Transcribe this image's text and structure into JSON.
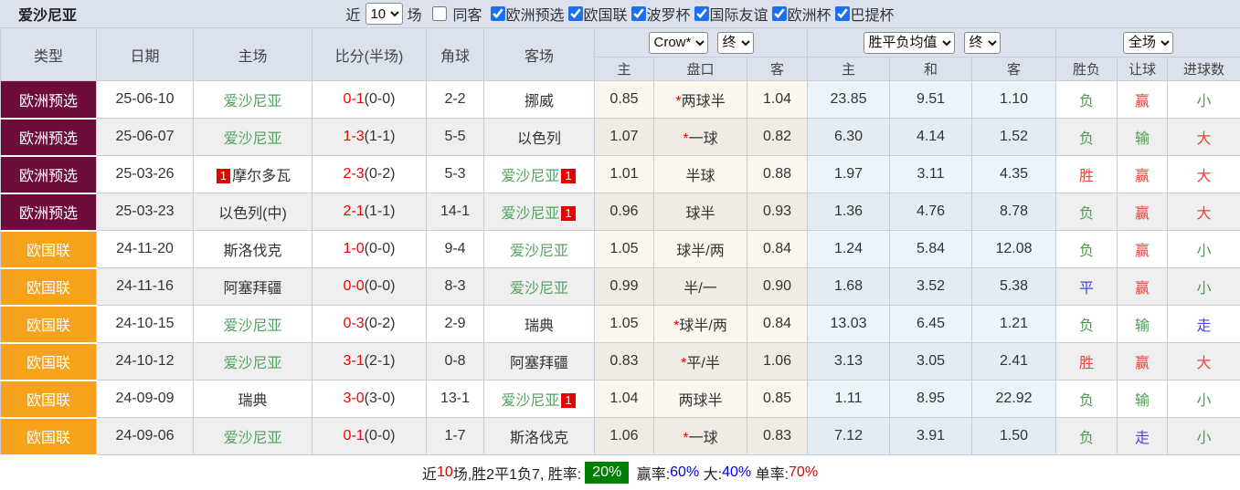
{
  "title": "爱沙尼亚",
  "topbar": {
    "near_label": "近",
    "near_value": "10",
    "games_label": "场",
    "same_away_label": "同客",
    "same_away_checked": false,
    "filters": [
      {
        "label": "欧洲预选",
        "checked": true
      },
      {
        "label": "欧国联",
        "checked": true
      },
      {
        "label": "波罗杯",
        "checked": true
      },
      {
        "label": "国际友谊",
        "checked": true
      },
      {
        "label": "欧洲杯",
        "checked": true
      },
      {
        "label": "巴提杯",
        "checked": true
      }
    ]
  },
  "header": {
    "cols": [
      "类型",
      "日期",
      "主场",
      "比分(半场)",
      "角球",
      "客场"
    ],
    "odds_company_dropdown": "Crow*",
    "odds_stage_dropdown": "终",
    "avg_type_dropdown": "胜平负均值",
    "avg_stage_dropdown": "终",
    "scope_dropdown": "全场",
    "sub_cols": [
      "主",
      "盘口",
      "客",
      "主",
      "和",
      "客",
      "胜负",
      "让球",
      "进球数"
    ]
  },
  "colors": {
    "league_maroon": "#6E0D3C",
    "league_orange": "#F7A21B",
    "team_highlight_green": "#55A163",
    "score_red": "#F00000",
    "result_red": "#E8453C",
    "result_green": "#4D9C51",
    "result_blue": "#4646E8",
    "footer_badge_green": "#008000"
  },
  "rows": [
    {
      "type": "欧洲预选",
      "type_color": "maroon",
      "date": "25-06-10",
      "home": "爱沙尼亚",
      "home_green": true,
      "home_badge_before": "",
      "home_badge_after": "",
      "score": "0-1",
      "half": "(0-0)",
      "corner": "2-2",
      "away": "挪威",
      "away_green": false,
      "away_badge_after": "",
      "odds_home": "0.85",
      "handicap_star": true,
      "handicap": "两球半",
      "odds_away": "1.04",
      "avg_win": "23.85",
      "avg_draw": "9.51",
      "avg_lose": "1.10",
      "result": {
        "text": "负",
        "color": "green"
      },
      "handicap_result": {
        "text": "赢",
        "color": "red"
      },
      "goals_result": {
        "text": "小",
        "color": "green"
      }
    },
    {
      "type": "欧洲预选",
      "type_color": "maroon",
      "date": "25-06-07",
      "home": "爱沙尼亚",
      "home_green": true,
      "home_badge_before": "",
      "home_badge_after": "",
      "score": "1-3",
      "half": "(1-1)",
      "corner": "5-5",
      "away": "以色列",
      "away_green": false,
      "away_badge_after": "",
      "odds_home": "1.07",
      "handicap_star": true,
      "handicap": "一球",
      "odds_away": "0.82",
      "avg_win": "6.30",
      "avg_draw": "4.14",
      "avg_lose": "1.52",
      "result": {
        "text": "负",
        "color": "green"
      },
      "handicap_result": {
        "text": "输",
        "color": "green"
      },
      "goals_result": {
        "text": "大",
        "color": "red"
      }
    },
    {
      "type": "欧洲预选",
      "type_color": "maroon",
      "date": "25-03-26",
      "home": "摩尔多瓦",
      "home_green": false,
      "home_badge_before": "1",
      "home_badge_after": "",
      "score": "2-3",
      "half": "(0-2)",
      "corner": "5-3",
      "away": "爱沙尼亚",
      "away_green": true,
      "away_badge_after": "1",
      "odds_home": "1.01",
      "handicap_star": false,
      "handicap": "半球",
      "odds_away": "0.88",
      "avg_win": "1.97",
      "avg_draw": "3.11",
      "avg_lose": "4.35",
      "result": {
        "text": "胜",
        "color": "red"
      },
      "handicap_result": {
        "text": "赢",
        "color": "red"
      },
      "goals_result": {
        "text": "大",
        "color": "red"
      }
    },
    {
      "type": "欧洲预选",
      "type_color": "maroon",
      "date": "25-03-23",
      "home": "以色列(中)",
      "home_green": false,
      "home_badge_before": "",
      "home_badge_after": "",
      "score": "2-1",
      "half": "(1-1)",
      "corner": "14-1",
      "away": "爱沙尼亚",
      "away_green": true,
      "away_badge_after": "1",
      "odds_home": "0.96",
      "handicap_star": false,
      "handicap": "球半",
      "odds_away": "0.93",
      "avg_win": "1.36",
      "avg_draw": "4.76",
      "avg_lose": "8.78",
      "result": {
        "text": "负",
        "color": "green"
      },
      "handicap_result": {
        "text": "赢",
        "color": "red"
      },
      "goals_result": {
        "text": "大",
        "color": "red"
      }
    },
    {
      "type": "欧国联",
      "type_color": "orange",
      "date": "24-11-20",
      "home": "斯洛伐克",
      "home_green": false,
      "home_badge_before": "",
      "home_badge_after": "",
      "score": "1-0",
      "half": "(0-0)",
      "corner": "9-4",
      "away": "爱沙尼亚",
      "away_green": true,
      "away_badge_after": "",
      "odds_home": "1.05",
      "handicap_star": false,
      "handicap": "球半/两",
      "odds_away": "0.84",
      "avg_win": "1.24",
      "avg_draw": "5.84",
      "avg_lose": "12.08",
      "result": {
        "text": "负",
        "color": "green"
      },
      "handicap_result": {
        "text": "赢",
        "color": "red"
      },
      "goals_result": {
        "text": "小",
        "color": "green"
      }
    },
    {
      "type": "欧国联",
      "type_color": "orange",
      "date": "24-11-16",
      "home": "阿塞拜疆",
      "home_green": false,
      "home_badge_before": "",
      "home_badge_after": "",
      "score": "0-0",
      "half": "(0-0)",
      "corner": "8-3",
      "away": "爱沙尼亚",
      "away_green": true,
      "away_badge_after": "",
      "odds_home": "0.99",
      "handicap_star": false,
      "handicap": "半/一",
      "odds_away": "0.90",
      "avg_win": "1.68",
      "avg_draw": "3.52",
      "avg_lose": "5.38",
      "result": {
        "text": "平",
        "color": "blue"
      },
      "handicap_result": {
        "text": "赢",
        "color": "red"
      },
      "goals_result": {
        "text": "小",
        "color": "green"
      }
    },
    {
      "type": "欧国联",
      "type_color": "orange",
      "date": "24-10-15",
      "home": "爱沙尼亚",
      "home_green": true,
      "home_badge_before": "",
      "home_badge_after": "",
      "score": "0-3",
      "half": "(0-2)",
      "corner": "2-9",
      "away": "瑞典",
      "away_green": false,
      "away_badge_after": "",
      "odds_home": "1.05",
      "handicap_star": true,
      "handicap": "球半/两",
      "odds_away": "0.84",
      "avg_win": "13.03",
      "avg_draw": "6.45",
      "avg_lose": "1.21",
      "result": {
        "text": "负",
        "color": "green"
      },
      "handicap_result": {
        "text": "输",
        "color": "green"
      },
      "goals_result": {
        "text": "走",
        "color": "blue"
      }
    },
    {
      "type": "欧国联",
      "type_color": "orange",
      "date": "24-10-12",
      "home": "爱沙尼亚",
      "home_green": true,
      "home_badge_before": "",
      "home_badge_after": "",
      "score": "3-1",
      "half": "(2-1)",
      "corner": "0-8",
      "away": "阿塞拜疆",
      "away_green": false,
      "away_badge_after": "",
      "odds_home": "0.83",
      "handicap_star": true,
      "handicap": "平/半",
      "odds_away": "1.06",
      "avg_win": "3.13",
      "avg_draw": "3.05",
      "avg_lose": "2.41",
      "result": {
        "text": "胜",
        "color": "red"
      },
      "handicap_result": {
        "text": "赢",
        "color": "red"
      },
      "goals_result": {
        "text": "大",
        "color": "red"
      }
    },
    {
      "type": "欧国联",
      "type_color": "orange",
      "date": "24-09-09",
      "home": "瑞典",
      "home_green": false,
      "home_badge_before": "",
      "home_badge_after": "",
      "score": "3-0",
      "half": "(3-0)",
      "corner": "13-1",
      "away": "爱沙尼亚",
      "away_green": true,
      "away_badge_after": "1",
      "odds_home": "1.04",
      "handicap_star": false,
      "handicap": "两球半",
      "odds_away": "0.85",
      "avg_win": "1.11",
      "avg_draw": "8.95",
      "avg_lose": "22.92",
      "result": {
        "text": "负",
        "color": "green"
      },
      "handicap_result": {
        "text": "输",
        "color": "green"
      },
      "goals_result": {
        "text": "小",
        "color": "green"
      }
    },
    {
      "type": "欧国联",
      "type_color": "orange",
      "date": "24-09-06",
      "home": "爱沙尼亚",
      "home_green": true,
      "home_badge_before": "",
      "home_badge_after": "",
      "score": "0-1",
      "half": "(0-0)",
      "corner": "1-7",
      "away": "斯洛伐克",
      "away_green": false,
      "away_badge_after": "",
      "odds_home": "1.06",
      "handicap_star": true,
      "handicap": "一球",
      "odds_away": "0.83",
      "avg_win": "7.12",
      "avg_draw": "3.91",
      "avg_lose": "1.50",
      "result": {
        "text": "负",
        "color": "green"
      },
      "handicap_result": {
        "text": "走",
        "color": "blue"
      },
      "goals_result": {
        "text": "小",
        "color": "green"
      }
    }
  ],
  "footer": {
    "segments": [
      {
        "text": "近",
        "style": "plain"
      },
      {
        "text": "10",
        "style": "red"
      },
      {
        "text": "场,胜2平1负7, 胜率:",
        "style": "plain"
      },
      {
        "text": "20%",
        "style": "badge"
      },
      {
        "text": " 赢率:",
        "style": "plain"
      },
      {
        "text": "60%",
        "style": "blue"
      },
      {
        "text": " 大:",
        "style": "plain"
      },
      {
        "text": "40%",
        "style": "blue"
      },
      {
        "text": " 单率:",
        "style": "plain"
      },
      {
        "text": "70%",
        "style": "red"
      }
    ]
  }
}
